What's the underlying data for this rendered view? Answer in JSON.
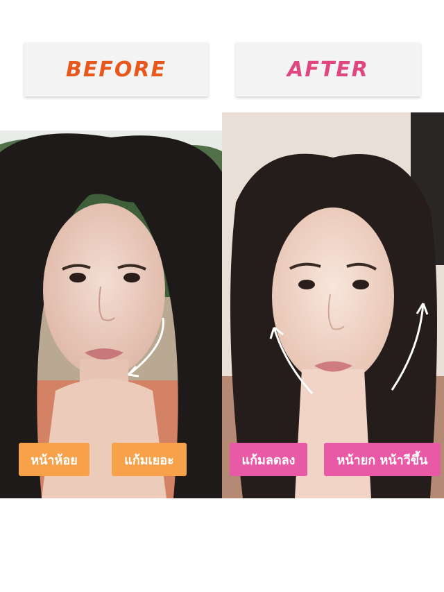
{
  "panels": {
    "before": {
      "title": "BEFORE",
      "title_color": "#e8571c",
      "tags": [
        "หน้าห้อย",
        "แก้มเยอะ"
      ],
      "tag_color": "#f7a24a"
    },
    "after": {
      "title": "AFTER",
      "title_color": "#e0467f",
      "tags": [
        "แก้มลดลง",
        "หน้ายก หน้าวีขึ้น"
      ],
      "tag_color": "#e85aa5"
    }
  }
}
